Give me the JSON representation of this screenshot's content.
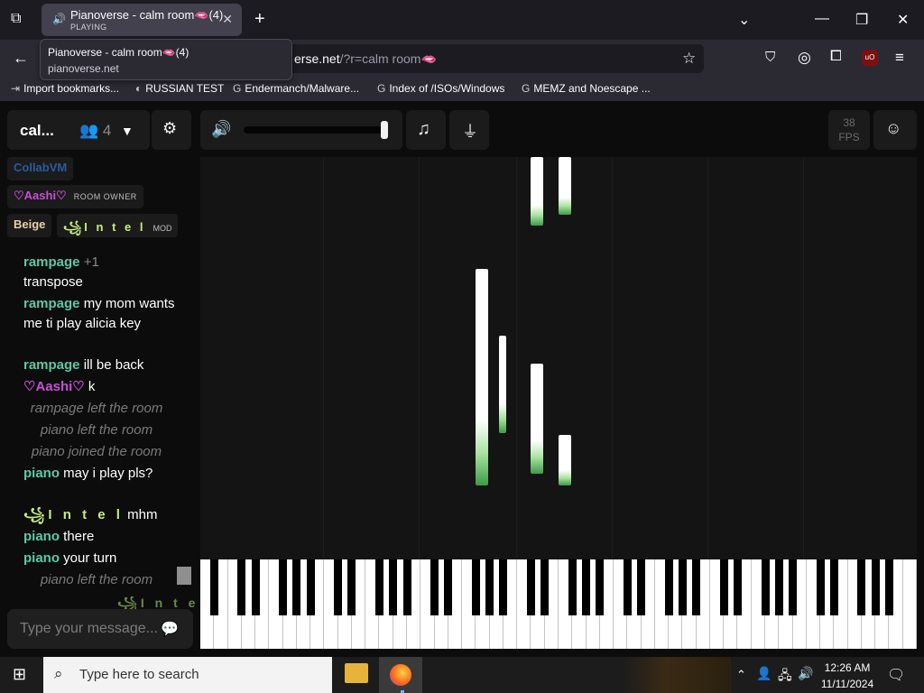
{
  "browser": {
    "tab_title": "Pianoverse - calm room🫦(4)",
    "tab_status": "PLAYING",
    "tooltip_title": "Pianoverse - calm room🫦(4)",
    "tooltip_domain": "pianoverse.net",
    "url_visible": "erse.net",
    "url_query": "/?r=calm room🫦",
    "bookmarks": [
      "Import bookmarks...",
      "RUSSIAN TEST",
      "Endermanch/Malware...",
      "Index of /ISOs/Windows",
      "MEMZ and Noescape ..."
    ]
  },
  "app": {
    "room_name": "cal...",
    "user_count": "4",
    "fps_value": "38",
    "fps_label": "FPS",
    "users": [
      {
        "name": "CollabVM",
        "color": "#2c5a9a"
      },
      {
        "name": "♡Aashi♡",
        "color": "#c94fd7",
        "badge": "ROOM OWNER"
      },
      {
        "name": "Beige",
        "color": "#e8d2ad"
      },
      {
        "name": "꧁I n t e l",
        "color": "#c5ef82",
        "badge": "MOD"
      }
    ],
    "chat": [
      {
        "user": "rampage",
        "text": "+1"
      },
      {
        "user": "",
        "text": "transpose"
      },
      {
        "user": "rampage",
        "text": "my mom wants me ti play alicia key"
      },
      {
        "user": "rampage",
        "text": "ill be back"
      },
      {
        "user": "♡Aashi♡",
        "text": "k"
      },
      {
        "system": "rampage left the room"
      },
      {
        "system": "piano left the room"
      },
      {
        "system": "piano joined the room"
      },
      {
        "user": "piano",
        "text": "may i play pls?"
      },
      {
        "user": "꧁I n t e l",
        "text": "mhm"
      },
      {
        "user": "piano",
        "text": "there"
      },
      {
        "user": "piano",
        "text": "your turn"
      },
      {
        "system": "piano left the room"
      },
      {
        "system": "꧁I n t e l"
      }
    ],
    "chat_placeholder": "Type your message..."
  },
  "taskbar": {
    "search_placeholder": "Type here to search",
    "time": "12:26 AM",
    "date": "11/11/2024"
  },
  "icons": [
    "tab-list-icon",
    "speaker-icon",
    "close-icon",
    "new-tab-icon",
    "back-icon",
    "bookmark-star-icon",
    "pocket-icon",
    "account-icon",
    "extensions-icon",
    "ublock-icon",
    "menu-icon",
    "users-icon",
    "gear-icon",
    "volume-icon",
    "music-note-icon",
    "usb-icon",
    "discord-icon",
    "chat-send-icon",
    "windows-start-icon",
    "search-icon",
    "file-explorer-icon",
    "firefox-icon",
    "network-icon",
    "volume-tray-icon",
    "notification-icon"
  ]
}
